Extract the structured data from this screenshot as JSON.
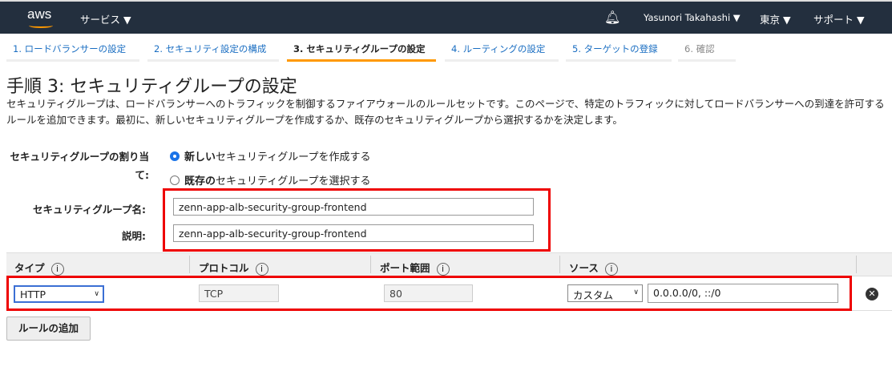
{
  "topbar": {
    "logo": "aws",
    "services": "サービス ▼",
    "user": "Yasunori Takahashi ▼",
    "region": "東京 ▼",
    "support": "サポート ▼"
  },
  "tabs": [
    "1. ロードバランサーの設定",
    "2. セキュリティ設定の構成",
    "3. セキュリティグループの設定",
    "4. ルーティングの設定",
    "5. ターゲットの登録",
    "6. 確認"
  ],
  "title": "手順 3: セキュリティグループの設定",
  "description": "セキュリティグループは、ロードバランサーへのトラフィックを制御するファイアウォールのルールセットです。このページで、特定のトラフィックに対してロードバランサーへの到達を許可するルールを追加できます。最初に、新しいセキュリティグループを作成するか、既存のセキュリティグループから選択するかを決定します。",
  "form": {
    "assign_label": "セキュリティグループの割り当て:",
    "option_new_bold": "新しい",
    "option_new_rest": "セキュリティグループを作成する",
    "option_existing_bold": "既存の",
    "option_existing_rest": "セキュリティグループを選択する",
    "name_label": "セキュリティグループ名:",
    "name_value": "zenn-app-alb-security-group-frontend",
    "desc_label": "説明:",
    "desc_value": "zenn-app-alb-security-group-frontend"
  },
  "table": {
    "headers": [
      "タイプ",
      "プロトコル",
      "ポート範囲",
      "ソース"
    ],
    "info": "i",
    "row": {
      "type": "HTTP",
      "protocol": "TCP",
      "port": "80",
      "source_type": "カスタム",
      "source": "0.0.0.0/0, ::/0"
    }
  },
  "add_rule": "ルールの追加"
}
